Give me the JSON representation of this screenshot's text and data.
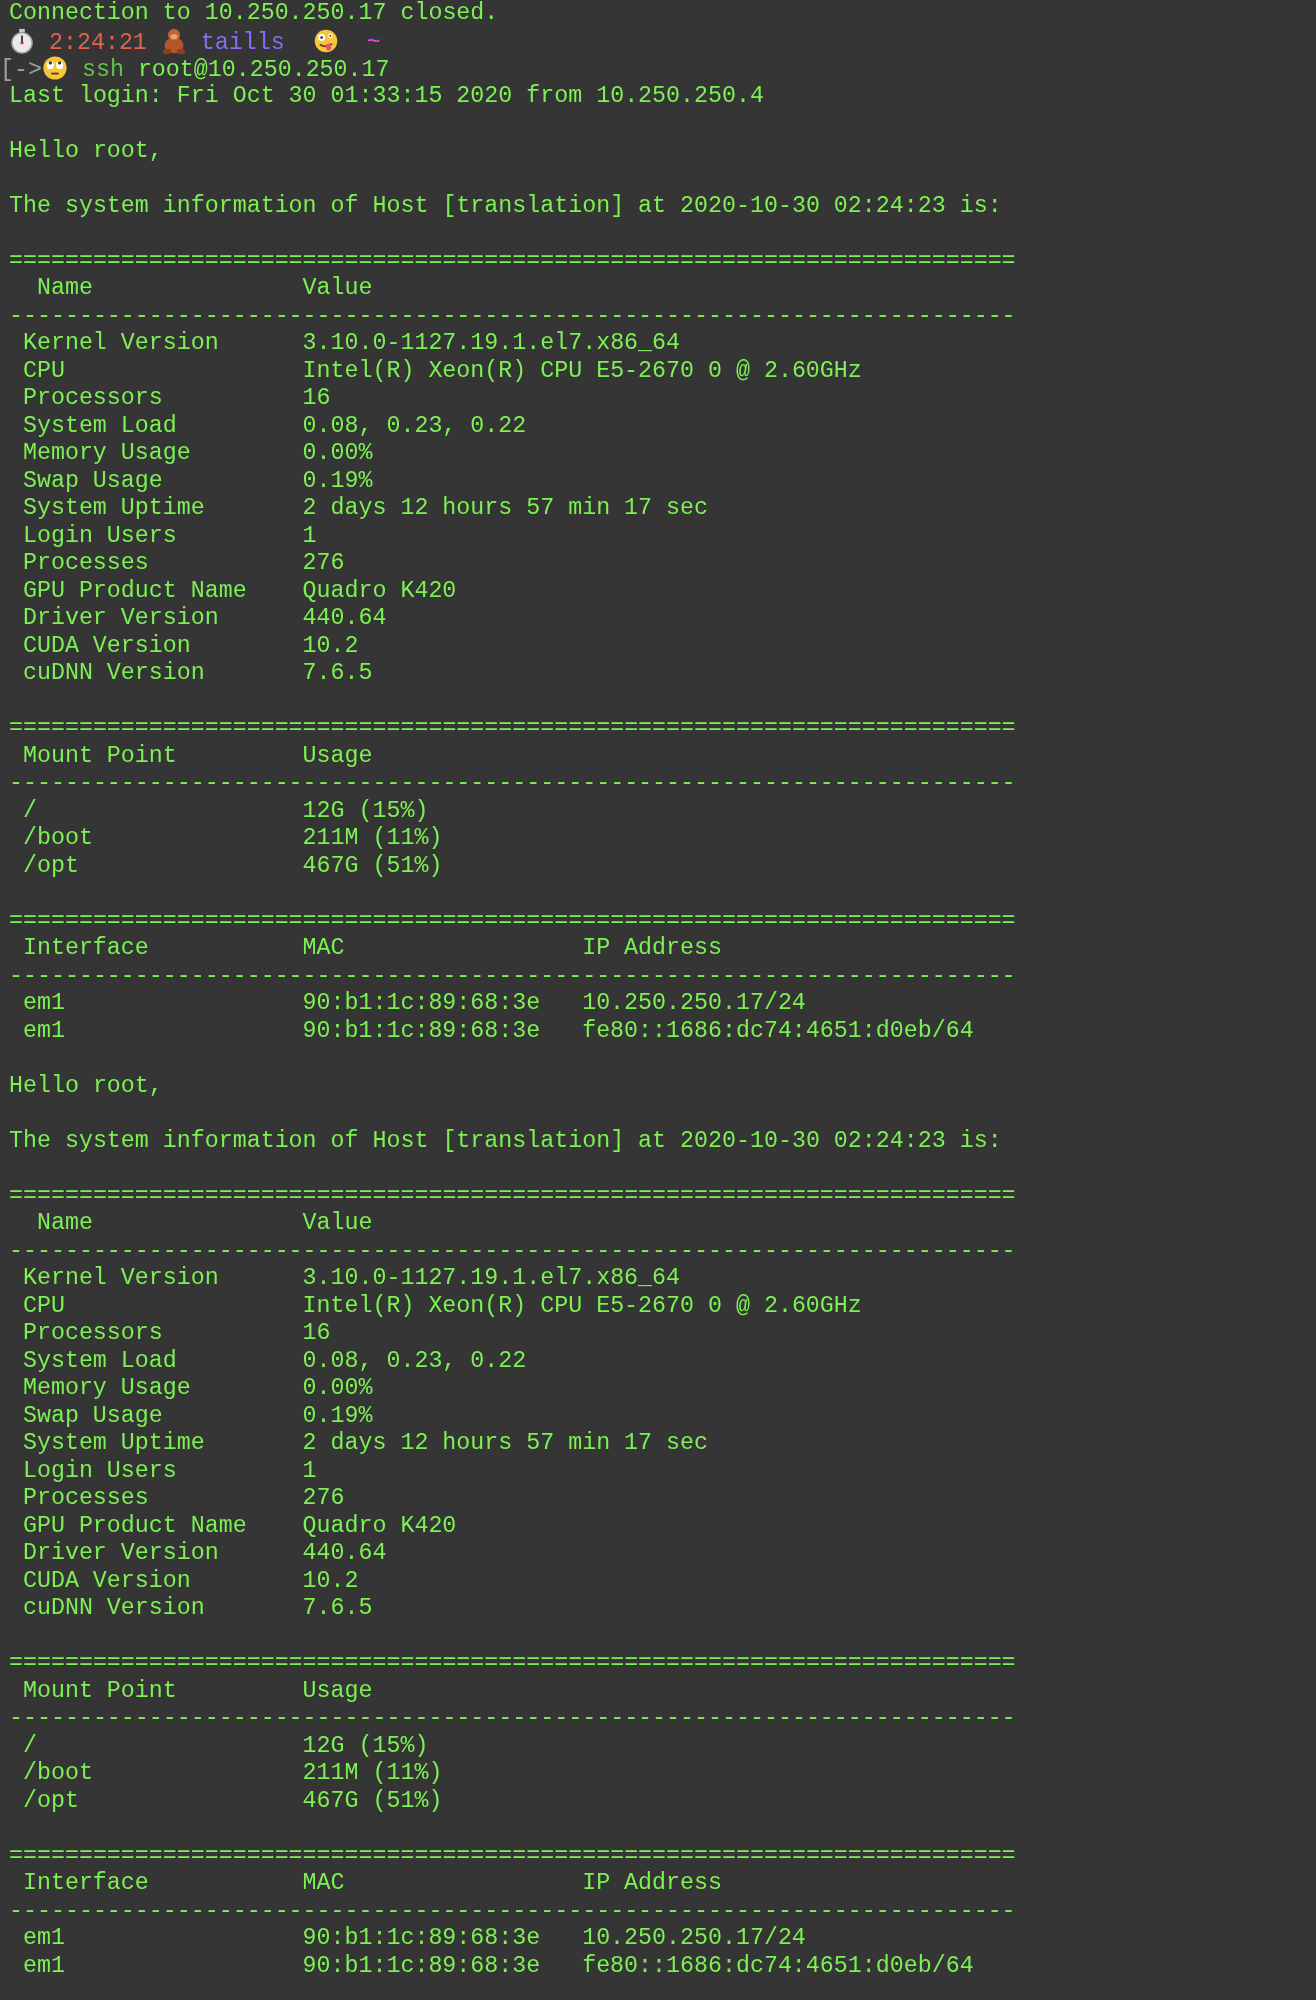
{
  "earlier_output": "Connection to 10.250.250.17 closed.",
  "prompt": {
    "time": "2:24:21",
    "user": "taills",
    "path": "~"
  },
  "command": {
    "prefix": "[->",
    "program": "ssh",
    "args": "root@10.250.250.17"
  },
  "last_login": "Last login: Fri Oct 30 01:33:15 2020 from 10.250.250.4",
  "reports": [
    {
      "greeting": "Hello root,",
      "info": "The system information of Host [translation] at 2020-10-30 02:24:23 is:",
      "sections": [
        {
          "top_rule": "========================================================================",
          "columns": [
            "Name",
            "Value"
          ],
          "rule": "------------------------------------------------------------------------",
          "rows": [
            [
              "Kernel Version",
              "3.10.0-1127.19.1.el7.x86_64"
            ],
            [
              "CPU",
              "Intel(R) Xeon(R) CPU E5-2670 0 @ 2.60GHz"
            ],
            [
              "Processors",
              "16"
            ],
            [
              "System Load",
              "0.08, 0.23, 0.22"
            ],
            [
              "Memory Usage",
              "0.00%"
            ],
            [
              "Swap Usage",
              "0.19%"
            ],
            [
              "System Uptime",
              "2 days 12 hours 57 min 17 sec"
            ],
            [
              "Login Users",
              "1"
            ],
            [
              "Processes",
              "276"
            ],
            [
              "GPU Product Name",
              "Quadro K420"
            ],
            [
              "Driver Version",
              "440.64"
            ],
            [
              "CUDA Version",
              "10.2"
            ],
            [
              "cuDNN Version",
              "7.6.5"
            ]
          ]
        },
        {
          "top_rule": "========================================================================",
          "columns": [
            "Mount Point",
            "Usage"
          ],
          "rule": "------------------------------------------------------------------------",
          "rows": [
            [
              "/",
              "12G (15%)"
            ],
            [
              "/boot",
              "211M (11%)"
            ],
            [
              "/opt",
              "467G (51%)"
            ]
          ]
        },
        {
          "top_rule": "========================================================================",
          "columns": [
            "Interface",
            "MAC",
            "IP Address"
          ],
          "rule": "------------------------------------------------------------------------",
          "rows": [
            [
              "em1",
              "90:b1:1c:89:68:3e",
              "10.250.250.17/24"
            ],
            [
              "em1",
              "90:b1:1c:89:68:3e",
              "fe80::1686:dc74:4651:d0eb/64"
            ]
          ]
        }
      ]
    },
    {
      "greeting": "Hello root,",
      "info": "The system information of Host [translation] at 2020-10-30 02:24:23 is:",
      "sections": [
        {
          "top_rule": "========================================================================",
          "columns": [
            "Name",
            "Value"
          ],
          "rule": "------------------------------------------------------------------------",
          "rows": [
            [
              "Kernel Version",
              "3.10.0-1127.19.1.el7.x86_64"
            ],
            [
              "CPU",
              "Intel(R) Xeon(R) CPU E5-2670 0 @ 2.60GHz"
            ],
            [
              "Processors",
              "16"
            ],
            [
              "System Load",
              "0.08, 0.23, 0.22"
            ],
            [
              "Memory Usage",
              "0.00%"
            ],
            [
              "Swap Usage",
              "0.19%"
            ],
            [
              "System Uptime",
              "2 days 12 hours 57 min 17 sec"
            ],
            [
              "Login Users",
              "1"
            ],
            [
              "Processes",
              "276"
            ],
            [
              "GPU Product Name",
              "Quadro K420"
            ],
            [
              "Driver Version",
              "440.64"
            ],
            [
              "CUDA Version",
              "10.2"
            ],
            [
              "cuDNN Version",
              "7.6.5"
            ]
          ]
        },
        {
          "top_rule": "========================================================================",
          "columns": [
            "Mount Point",
            "Usage"
          ],
          "rule": "------------------------------------------------------------------------",
          "rows": [
            [
              "/",
              "12G (15%)"
            ],
            [
              "/boot",
              "211M (11%)"
            ],
            [
              "/opt",
              "467G (51%)"
            ]
          ]
        },
        {
          "top_rule": "========================================================================",
          "columns": [
            "Interface",
            "MAC",
            "IP Address"
          ],
          "rule": "------------------------------------------------------------------------",
          "rows": [
            [
              "em1",
              "90:b1:1c:89:68:3e",
              "10.250.250.17/24"
            ],
            [
              "em1",
              "90:b1:1c:89:68:3e",
              "fe80::1686:dc74:4651:d0eb/64"
            ]
          ]
        }
      ]
    }
  ]
}
